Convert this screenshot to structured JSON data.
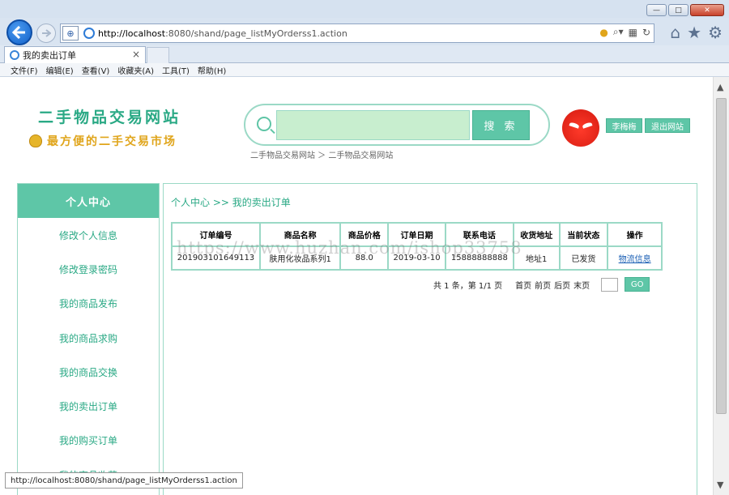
{
  "window": {
    "minimize": "—",
    "maximize": "□",
    "close": "✕"
  },
  "nav": {
    "url_host": "http://localhost",
    "url_path": ":8080/shand/page_listMyOrderss1.action",
    "back_icon": "arrow-left-icon",
    "forward_icon": "arrow-right-icon"
  },
  "tab": {
    "title": "我的卖出订单",
    "close": "×"
  },
  "menu": [
    "文件(F)",
    "编辑(E)",
    "查看(V)",
    "收藏夹(A)",
    "工具(T)",
    "帮助(H)"
  ],
  "header": {
    "site_title": "二手物品交易网站",
    "slogan": "最方便的二手交易市场",
    "search_placeholder": "",
    "search_button": "搜 索",
    "breadcrumb": "二手物品交易网站 ＞ 二手物品交易网站",
    "user_name": "李梅梅",
    "logout": "退出网站"
  },
  "sidebar": {
    "title": "个人中心",
    "items": [
      "修改个人信息",
      "修改登录密码",
      "我的商品发布",
      "我的商品求购",
      "我的商品交换",
      "我的卖出订单",
      "我的购买订单",
      "我的商品收藏"
    ]
  },
  "main": {
    "breadcrumb": "个人中心 >> 我的卖出订单",
    "columns": [
      "订单编号",
      "商品名称",
      "商品价格",
      "订单日期",
      "联系电话",
      "收货地址",
      "当前状态",
      "操作"
    ],
    "rows": [
      [
        "201903101649113",
        "肤用化妆品系列1",
        "88.0",
        "2019-03-10",
        "15888888888",
        "地址1",
        "已发货",
        "物流信息"
      ]
    ],
    "pager": {
      "summary": "共 1 条，第 1/1 页",
      "first": "首页",
      "prev": "前页",
      "next": "后页",
      "last": "末页",
      "go": "GO"
    }
  },
  "watermark": "https://www.huzhan.com/ishop33758",
  "status_url": "http://localhost:8080/shand/page_listMyOrderss1.action",
  "colors": {
    "accent": "#5ec6a7",
    "accent_text": "#2aa985",
    "slogan": "#e0a51b",
    "search_fill": "#c8eecf"
  }
}
